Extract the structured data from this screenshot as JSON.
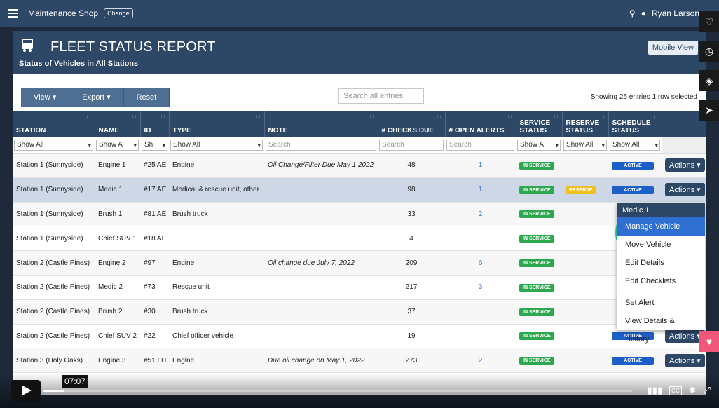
{
  "topbar": {
    "shop": "Maintenance Shop",
    "change": "Change",
    "user": "Ryan Larson"
  },
  "report": {
    "title": "FLEET STATUS REPORT",
    "subtitle": "Status of Vehicles in All Stations",
    "mobile_view": "Mobile View"
  },
  "toolbar": {
    "view": "View ▾",
    "export": "Export ▾",
    "reset": "Reset",
    "search_placeholder": "Search all entries",
    "showing": "Showing 25 entries   1 row selected"
  },
  "columns": [
    "STATION",
    "NAME",
    "ID",
    "TYPE",
    "NOTE",
    "# CHECKS DUE",
    "# OPEN ALERTS",
    "SERVICE STATUS",
    "RESERVE STATUS",
    "SCHEDULE STATUS",
    ""
  ],
  "filters": [
    "Show All",
    "Show A",
    "Sh",
    "Show All",
    "Search",
    "Search",
    "Search",
    "Show A",
    "Show All",
    "Show All",
    ""
  ],
  "rows": [
    {
      "station": "Station 1 (Sunnyside)",
      "name": "Engine 1",
      "id": "#25 AE",
      "type": "Engine",
      "note": "Oil Change/Filter Due May 1 2022",
      "checks": "48",
      "alerts": "1",
      "service": "IN SERVICE",
      "reserve": "",
      "schedule": "ACTIVE",
      "action": "Actions ▾"
    },
    {
      "station": "Station 1 (Sunnyside)",
      "name": "Medic 1",
      "id": "#17 AE",
      "type": "Medical & rescue unit, other",
      "note": "",
      "checks": "98",
      "alerts": "1",
      "service": "IN SERVICE",
      "reserve": "RESERVE",
      "schedule": "ACTIVE",
      "action": "Actions ▾"
    },
    {
      "station": "Station 1 (Sunnyside)",
      "name": "Brush 1",
      "id": "#81 AE",
      "type": "Brush truck",
      "note": "",
      "checks": "33",
      "alerts": "2",
      "service": "IN SERVICE",
      "reserve": "",
      "schedule": "",
      "action": ""
    },
    {
      "station": "Station 1 (Sunnyside)",
      "name": "Chief SUV 1",
      "id": "#18 AE",
      "type": "",
      "note": "",
      "checks": "4",
      "alerts": "",
      "service": "IN SERVICE",
      "reserve": "",
      "schedule": "",
      "action": ""
    },
    {
      "station": "Station 2 (Castle Pines)",
      "name": "Engine 2",
      "id": "#97",
      "type": "Engine",
      "note": "Oil change due July 7, 2022",
      "checks": "209",
      "alerts": "6",
      "service": "IN SERVICE",
      "reserve": "",
      "schedule": "",
      "action": ""
    },
    {
      "station": "Station 2 (Castle Pines)",
      "name": "Medic 2",
      "id": "#73",
      "type": "Rescue unit",
      "note": "",
      "checks": "217",
      "alerts": "3",
      "service": "IN SERVICE",
      "reserve": "",
      "schedule": "",
      "action": ""
    },
    {
      "station": "Station 2 (Castle Pines)",
      "name": "Brush 2",
      "id": "#30",
      "type": "Brush truck",
      "note": "",
      "checks": "37",
      "alerts": "",
      "service": "IN SERVICE",
      "reserve": "",
      "schedule": "",
      "action": ""
    },
    {
      "station": "Station 2 (Castle Pines)",
      "name": "Chief SUV 2",
      "id": "#22",
      "type": "Chief officer vehicle",
      "note": "",
      "checks": "19",
      "alerts": "",
      "service": "IN SERVICE",
      "reserve": "",
      "schedule": "ACTIVE",
      "action": "Actions ▾"
    },
    {
      "station": "Station 3 (Holy Oaks)",
      "name": "Engine 3",
      "id": "#51 LH",
      "type": "Engine",
      "note": "Due oil change on May 1, 2022",
      "checks": "273",
      "alerts": "2",
      "service": "IN SERVICE",
      "reserve": "",
      "schedule": "ACTIVE",
      "action": "Actions ▾"
    }
  ],
  "menu": {
    "header": "Medic 1",
    "items": [
      "Manage Vehicle",
      "Move Vehicle",
      "Edit Details",
      "Edit Checklists",
      "Set Alert",
      "View Details & History"
    ]
  },
  "video": {
    "time": "07:07",
    "cc": "CC"
  }
}
